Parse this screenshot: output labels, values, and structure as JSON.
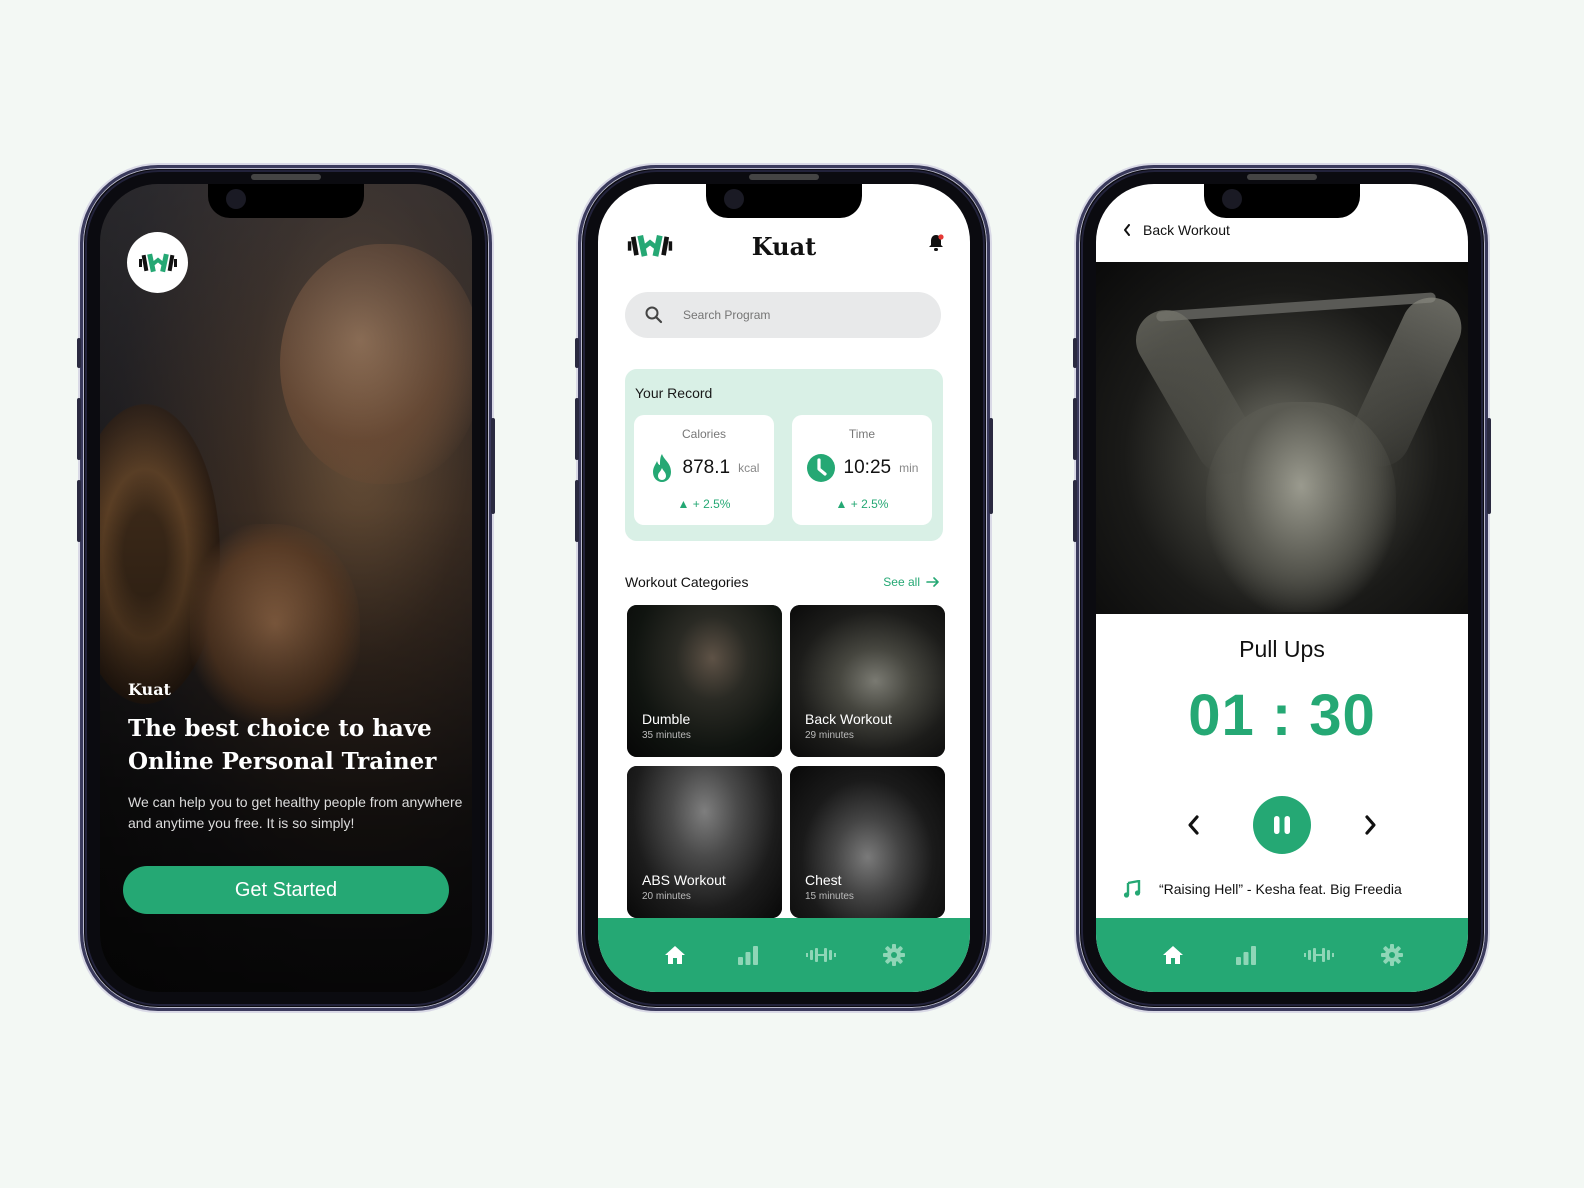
{
  "colors": {
    "accent": "#25a874",
    "record_bg": "#d9f0e6",
    "page_bg": "#f3f8f4",
    "notification_dot": "#e53935"
  },
  "onboarding": {
    "logo_icon": "dumbbell-logo-icon",
    "brand": "Kuat",
    "headline": "The best choice to have Online Personal Trainer",
    "subtitle": "We can help you to get healthy people from anywhere and anytime you free.  It is so simply!",
    "cta_label": "Get Started"
  },
  "home": {
    "app_title": "Kuat",
    "bell_icon": "bell-icon",
    "search": {
      "placeholder": "Search Program",
      "value": ""
    },
    "record": {
      "title": "Your Record",
      "stats": [
        {
          "label": "Calories",
          "value": "878.1",
          "unit": "kcal",
          "delta": "+ 2.5%",
          "icon": "flame-icon"
        },
        {
          "label": "Time",
          "value": "10:25",
          "unit": "min",
          "delta": "+ 2.5%",
          "icon": "clock-icon"
        }
      ]
    },
    "categories": {
      "title": "Workout Categories",
      "see_all": "See all",
      "items": [
        {
          "name": "Dumble",
          "duration": "35 minutes"
        },
        {
          "name": "Back Workout",
          "duration": "29 minutes"
        },
        {
          "name": "ABS Workout",
          "duration": "20 minutes"
        },
        {
          "name": "Chest",
          "duration": "15 minutes"
        }
      ]
    }
  },
  "tabbar": {
    "items": [
      {
        "name": "home",
        "icon": "home-icon",
        "active": true
      },
      {
        "name": "stats",
        "icon": "bar-chart-icon",
        "active": false
      },
      {
        "name": "workout",
        "icon": "dumbbell-icon",
        "active": false
      },
      {
        "name": "settings",
        "icon": "gear-icon",
        "active": false
      }
    ]
  },
  "player": {
    "back_label": "Back Workout",
    "exercise": "Pull Ups",
    "timer": "01 : 30",
    "song": "“Raising Hell” - Kesha feat. Big Freedia"
  }
}
